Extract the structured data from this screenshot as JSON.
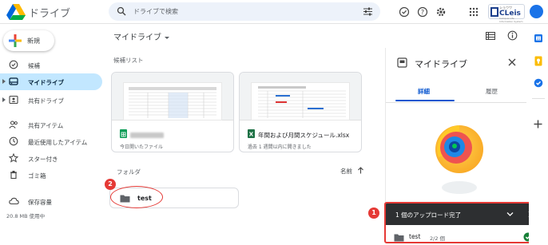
{
  "header": {
    "app_title": "ドライブ",
    "search_placeholder": "ドライブで検索",
    "brand": {
      "small": "ショウワ",
      "big": "CLeis",
      "sub": "Campus Life Information System"
    }
  },
  "sidebar": {
    "new_button": "新規",
    "items": [
      {
        "label": "候補",
        "icon": "check-circle-icon"
      },
      {
        "label": "マイドライブ",
        "icon": "drive-icon",
        "active": true
      },
      {
        "label": "共有ドライブ",
        "icon": "shared-drive-icon"
      },
      {
        "label": "共有アイテム",
        "icon": "people-icon"
      },
      {
        "label": "最近使用したアイテム",
        "icon": "clock-icon"
      },
      {
        "label": "スター付き",
        "icon": "star-icon"
      },
      {
        "label": "ゴミ箱",
        "icon": "trash-icon"
      },
      {
        "label": "保存容量",
        "icon": "cloud-icon"
      }
    ],
    "storage_used": "20.8 MB 使用中"
  },
  "main": {
    "title": "マイドライブ",
    "suggested_label": "候補リスト",
    "cards": [
      {
        "name": "",
        "subtitle": "今日開いたファイル",
        "type": "sheets",
        "color": "#0f9d58"
      },
      {
        "name": "年間および月間スケジュール.xlsx",
        "subtitle": "過去 1 週間以内に開きました",
        "type": "excel",
        "color": "#1e7145"
      }
    ],
    "folders_label": "フォルダ",
    "sort_label": "名前",
    "folder": {
      "name": "test"
    },
    "badge_2": "2"
  },
  "details": {
    "title": "マイドライブ",
    "tabs": [
      "詳細",
      "履歴"
    ]
  },
  "upload": {
    "badge_1": "1",
    "title": "1 個のアップロード完了",
    "file_name": "test",
    "count": "2/2 個"
  },
  "colors": {
    "accent": "#0b57d0",
    "active_bg": "#c2e7ff",
    "annotation_red": "#e53935",
    "success_green": "#188038"
  }
}
